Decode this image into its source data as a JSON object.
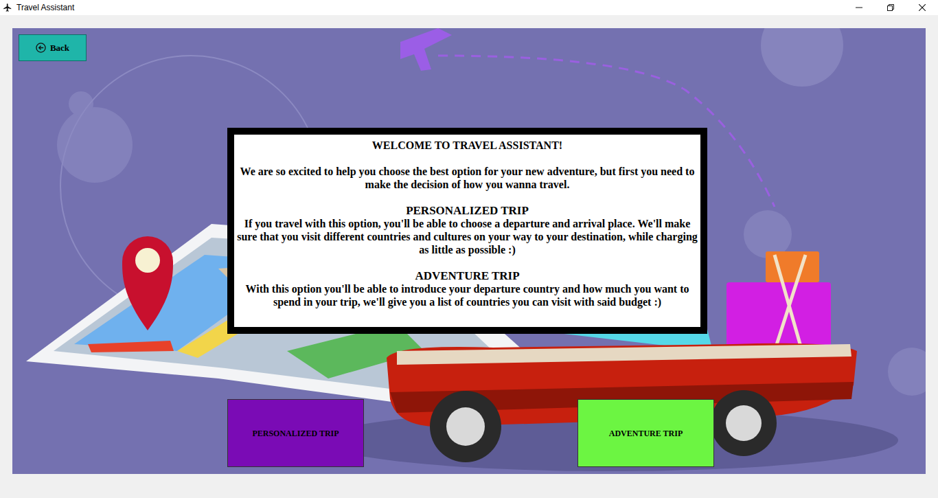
{
  "window": {
    "title": "Travel Assistant"
  },
  "back_button": {
    "label": "Back"
  },
  "dialog": {
    "title": "WELCOME TO TRAVEL ASSISTANT!",
    "intro": "We are so excited to help you choose the best option for your new adventure, but first you need to make the decision of how you wanna travel.",
    "sections": [
      {
        "heading": "PERSONALIZED TRIP",
        "body": "If you travel with this option, you'll be able to choose a departure and arrival place. We'll make sure that you visit different countries and cultures on your way to your destination, while charging as little as possible :)"
      },
      {
        "heading": "ADVENTURE TRIP",
        "body": "With this option you'll be able to introduce your departure country and how much you want to spend in your trip, we'll give you a list of countries you can visit with said budget :)"
      }
    ]
  },
  "options": [
    {
      "label": "PERSONALIZED TRIP",
      "color": "#7a0bb5"
    },
    {
      "label": "ADVENTURE TRIP",
      "color": "#6cf542"
    }
  ]
}
